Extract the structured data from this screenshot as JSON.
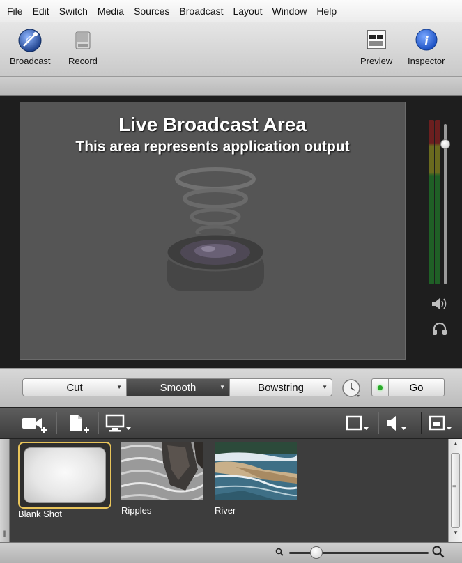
{
  "menu": [
    "File",
    "Edit",
    "Switch",
    "Media",
    "Sources",
    "Broadcast",
    "Layout",
    "Window",
    "Help"
  ],
  "toolbar": {
    "broadcast_label": "Broadcast",
    "record_label": "Record",
    "preview_label": "Preview",
    "inspector_label": "Inspector"
  },
  "preview": {
    "title": "Live Broadcast Area",
    "subtitle": "This area represents application output"
  },
  "transitions": {
    "items": [
      "Cut",
      "Smooth",
      "Bowstring"
    ],
    "selected": "Smooth",
    "go_label": "Go"
  },
  "media_toolbar": {
    "icons": [
      "add-camera-icon",
      "add-file-icon",
      "add-screen-icon",
      "layout-icon",
      "audio-icon",
      "output-icon"
    ]
  },
  "shots": [
    {
      "name": "Blank Shot",
      "selected": true
    },
    {
      "name": "Ripples",
      "selected": false
    },
    {
      "name": "River",
      "selected": false
    }
  ],
  "zoom": {
    "level": 0.2
  },
  "colors": {
    "accent": "#e8c45a",
    "go_led": "#2ba82b",
    "broadcast_icon": "#2a5fb0"
  }
}
